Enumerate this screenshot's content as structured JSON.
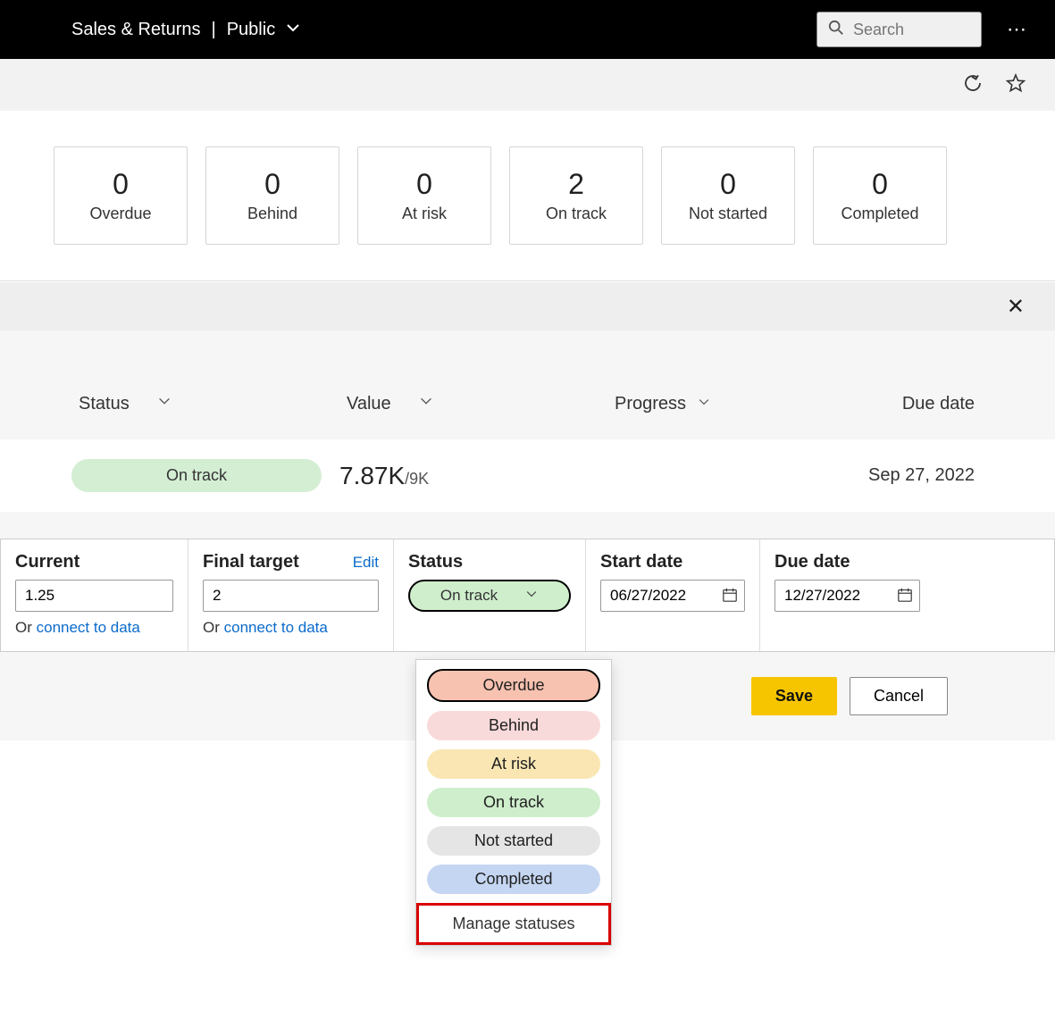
{
  "header": {
    "app_title": "Sales & Returns",
    "workspace": "Public",
    "search_placeholder": "Search"
  },
  "cards": [
    {
      "count": "0",
      "label": "Overdue"
    },
    {
      "count": "0",
      "label": "Behind"
    },
    {
      "count": "0",
      "label": "At risk"
    },
    {
      "count": "2",
      "label": "On track"
    },
    {
      "count": "0",
      "label": "Not started"
    },
    {
      "count": "0",
      "label": "Completed"
    }
  ],
  "columns": {
    "status": "Status",
    "value": "Value",
    "progress": "Progress",
    "due": "Due date"
  },
  "row": {
    "status": "On track",
    "value_main": "7.87K",
    "value_denom": "/9K",
    "due": "Sep 27, 2022"
  },
  "form": {
    "current_label": "Current",
    "current_value": "1.25",
    "final_label": "Final target",
    "final_value": "2",
    "edit": "Edit",
    "status_label": "Status",
    "status_value": "On track",
    "start_label": "Start date",
    "start_value": "06/27/2022",
    "due_label": "Due date",
    "due_value": "12/27/2022",
    "or_text": "Or ",
    "connect": "connect to data"
  },
  "dropdown": {
    "overdue": "Overdue",
    "behind": "Behind",
    "atrisk": "At risk",
    "ontrack": "On track",
    "notstarted": "Not started",
    "completed": "Completed",
    "manage": "Manage statuses"
  },
  "actions": {
    "save": "Save",
    "cancel": "Cancel"
  }
}
